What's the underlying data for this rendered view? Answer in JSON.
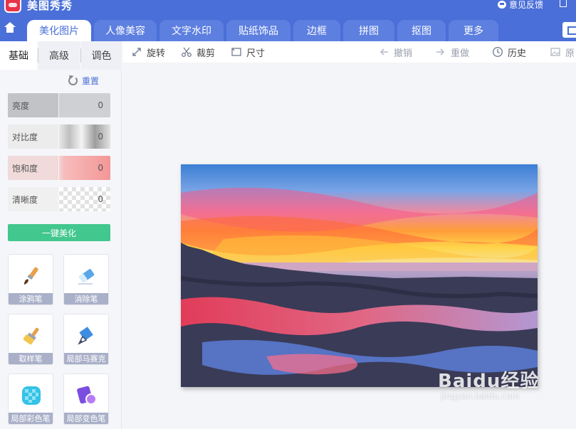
{
  "app": {
    "title": "美图秀秀"
  },
  "titlebar": {
    "feedback": "意见反馈"
  },
  "tabs": [
    {
      "label": "美化图片",
      "active": true
    },
    {
      "label": "人像美容"
    },
    {
      "label": "文字水印"
    },
    {
      "label": "贴纸饰品"
    },
    {
      "label": "边框"
    },
    {
      "label": "拼图"
    },
    {
      "label": "抠图"
    },
    {
      "label": "更多"
    }
  ],
  "subtabs": [
    {
      "label": "基础",
      "active": true
    },
    {
      "label": "高级"
    },
    {
      "label": "调色"
    }
  ],
  "reset_label": "重置",
  "adjustments": [
    {
      "label": "亮度",
      "value": "0"
    },
    {
      "label": "对比度",
      "value": "0"
    },
    {
      "label": "饱和度",
      "value": "0"
    },
    {
      "label": "清晰度",
      "value": "0"
    }
  ],
  "one_click_label": "一键美化",
  "tools": [
    {
      "label": "涂鸦笔",
      "icon": "paintbrush-icon"
    },
    {
      "label": "消除笔",
      "icon": "eraser-icon"
    },
    {
      "label": "取样笔",
      "icon": "sample-brush-icon"
    },
    {
      "label": "局部马赛克",
      "display": "局部马赛克",
      "icon": "mosaic-pen-icon"
    },
    {
      "label": "局部彩色笔",
      "icon": "color-brush-icon"
    },
    {
      "label": "局部变色笔",
      "icon": "recolor-brush-icon"
    }
  ],
  "toolbar": {
    "rotate": "旋转",
    "crop": "裁剪",
    "size": "尺寸",
    "undo": "撤销",
    "redo": "重做",
    "history": "历史",
    "original": "原"
  },
  "watermark": {
    "main": "Baidu经验",
    "sub": "jingyan.baidu.com"
  },
  "colors": {
    "brand": "#4a6fd8",
    "accent_green": "#42c78e"
  }
}
